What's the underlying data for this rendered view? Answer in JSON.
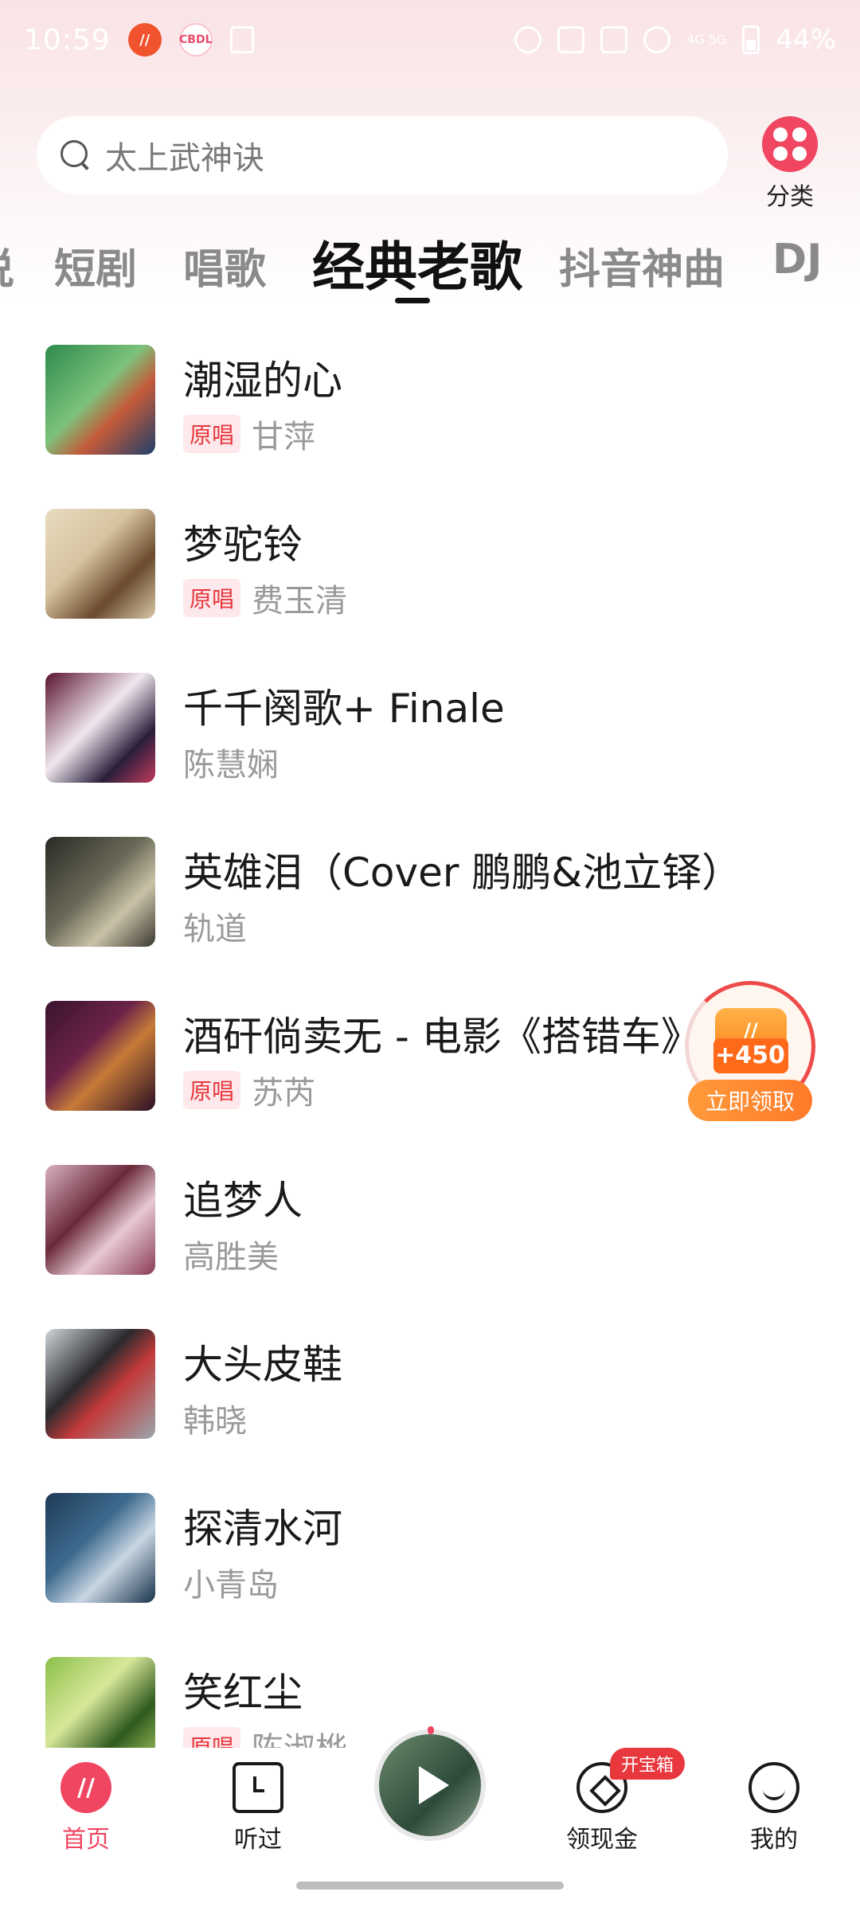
{
  "status_bar": {
    "time": "10:59",
    "app_icon_1": "music-app",
    "app_icon_2": "CBDL",
    "network": "4G 5G",
    "battery": "44%"
  },
  "search": {
    "placeholder": "太上武神诀"
  },
  "category": {
    "label": "分类"
  },
  "tabs": [
    {
      "label": "说"
    },
    {
      "label": "短剧"
    },
    {
      "label": "唱歌"
    },
    {
      "label": "经典老歌",
      "active": true
    },
    {
      "label": "抖音神曲"
    },
    {
      "label": "DJ"
    }
  ],
  "songs": [
    {
      "title": "潮湿的心",
      "badge": "原唱",
      "singer": "甘萍"
    },
    {
      "title": "梦驼铃",
      "badge": "原唱",
      "singer": "费玉清"
    },
    {
      "title": "千千阕歌+ Finale",
      "badge": "",
      "singer": "陈慧娴"
    },
    {
      "title": "英雄泪（Cover 鹏鹏&池立铎）",
      "badge": "",
      "singer": "轨道"
    },
    {
      "title": "酒矸倘卖无 - 电影《搭错车》",
      "badge": "原唱",
      "singer": "苏芮"
    },
    {
      "title": "追梦人",
      "badge": "",
      "singer": "高胜美"
    },
    {
      "title": "大头皮鞋",
      "badge": "",
      "singer": "韩晓"
    },
    {
      "title": "探清水河",
      "badge": "",
      "singer": "小青岛"
    },
    {
      "title": "笑红尘",
      "badge": "原唱",
      "singer": "陈淑桦"
    }
  ],
  "reward": {
    "amount": "+450",
    "button_label": "立即领取"
  },
  "bottom_nav": {
    "home": "首页",
    "history": "听过",
    "cash": "领现金",
    "treasure_badge": "开宝箱",
    "me": "我的"
  },
  "colors": {
    "accent": "#f04662",
    "badge_red": "#e8383d",
    "reward_orange": "#ff7a2a"
  }
}
